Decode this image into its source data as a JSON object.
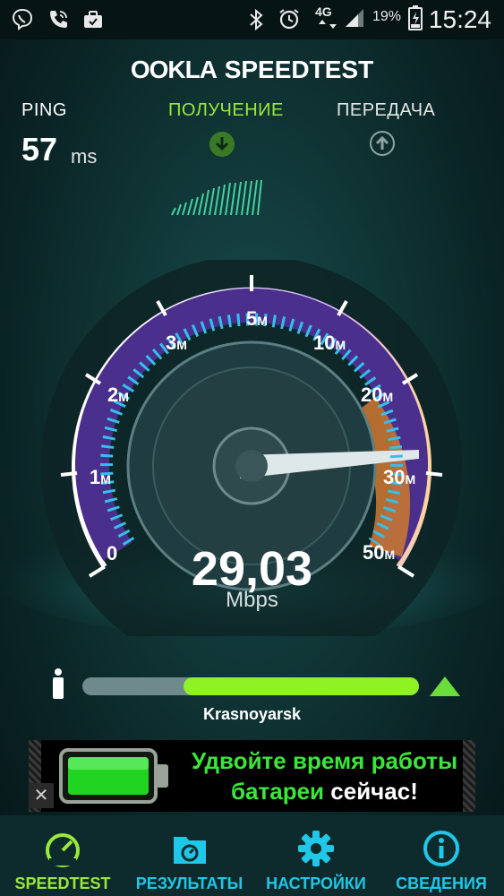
{
  "status_bar": {
    "network": "4G",
    "battery": "19%",
    "time": "15:24"
  },
  "header": {
    "brand_ookla": "OOKLA",
    "brand_speedtest": "SPEEDTEST"
  },
  "metrics": {
    "ping_label": "PING",
    "ping_value": "57",
    "ping_unit": "ms",
    "download_label": "ПОЛУЧЕНИЕ",
    "upload_label": "ПЕРЕДАЧА"
  },
  "gauge": {
    "tick_labels": [
      {
        "num": "0",
        "unit": ""
      },
      {
        "num": "1",
        "unit": "M"
      },
      {
        "num": "2",
        "unit": "M"
      },
      {
        "num": "3",
        "unit": "M"
      },
      {
        "num": "5",
        "unit": "M"
      },
      {
        "num": "10",
        "unit": "M"
      },
      {
        "num": "20",
        "unit": "M"
      },
      {
        "num": "30",
        "unit": "M"
      },
      {
        "num": "50",
        "unit": "M"
      }
    ],
    "current_value": "29,03",
    "unit": "Mbps"
  },
  "server": {
    "city": "Krasnoyarsk",
    "progress_fraction": 0.7
  },
  "ad": {
    "line1": "Удвойте время работы",
    "line2_green": "батареи",
    "line2_white": "сейчас!",
    "close_glyph": "✕"
  },
  "nav": [
    {
      "label": "SPEEDTEST",
      "icon": "speedometer-icon",
      "active": true
    },
    {
      "label": "РЕЗУЛЬТАТЫ",
      "icon": "results-folder-icon",
      "active": false
    },
    {
      "label": "НАСТРОЙКИ",
      "icon": "gear-icon",
      "active": false
    },
    {
      "label": "СВЕДЕНИЯ",
      "icon": "info-icon",
      "active": false
    }
  ],
  "colors": {
    "accent_green": "#9ae83a",
    "accent_cyan": "#20c7e6",
    "progress_fill": "#8ff225"
  }
}
